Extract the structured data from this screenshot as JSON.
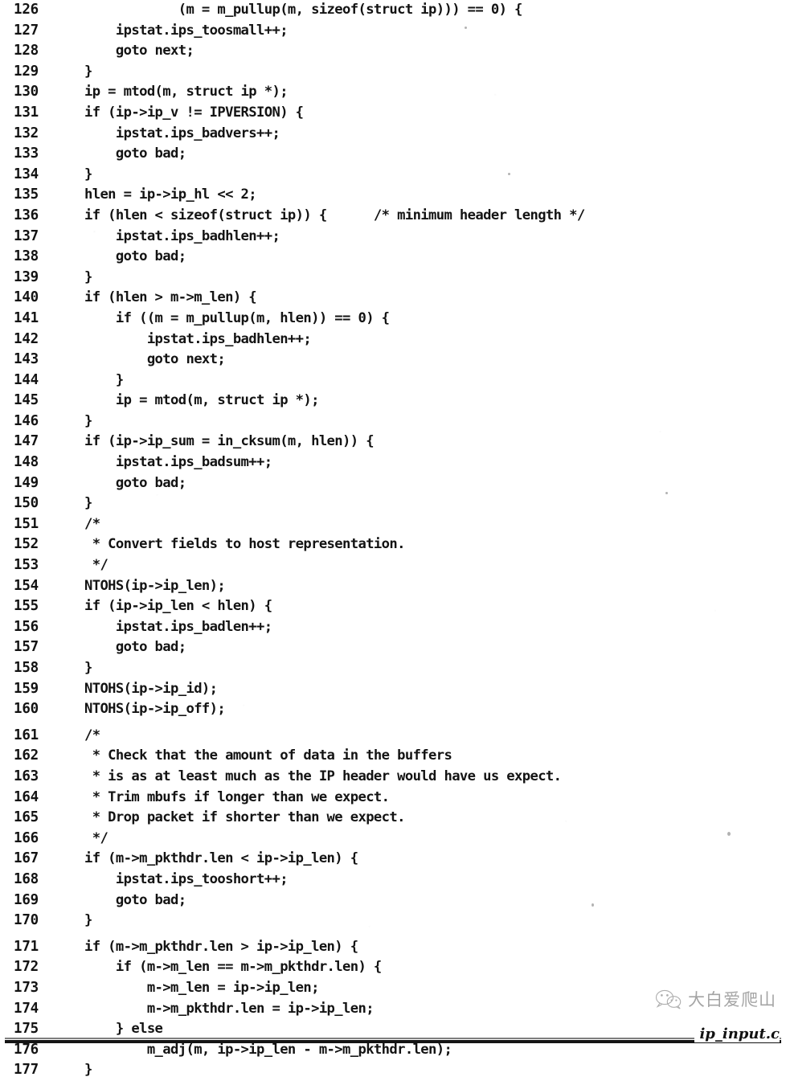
{
  "document": {
    "kind": "scanned-book-page",
    "footer_filename": "ip_input.c",
    "first_line_number": 126,
    "last_line_number": 177
  },
  "watermark": {
    "icon": "wechat-logo-icon",
    "text": "大白爱爬山"
  },
  "code": {
    "language": "c",
    "lines": [
      {
        "no": "126",
        "text": "            (m = m_pullup(m, sizeof(struct ip))) == 0) {",
        "gap_before": false
      },
      {
        "no": "127",
        "text": "    ipstat.ips_toosmall++;",
        "gap_before": false
      },
      {
        "no": "128",
        "text": "    goto next;",
        "gap_before": false
      },
      {
        "no": "129",
        "text": "}",
        "gap_before": false
      },
      {
        "no": "130",
        "text": "ip = mtod(m, struct ip *);",
        "gap_before": false
      },
      {
        "no": "131",
        "text": "if (ip->ip_v != IPVERSION) {",
        "gap_before": false
      },
      {
        "no": "132",
        "text": "    ipstat.ips_badvers++;",
        "gap_before": false
      },
      {
        "no": "133",
        "text": "    goto bad;",
        "gap_before": false
      },
      {
        "no": "134",
        "text": "}",
        "gap_before": false
      },
      {
        "no": "135",
        "text": "hlen = ip->ip_hl << 2;",
        "gap_before": false
      },
      {
        "no": "136",
        "text": "if (hlen < sizeof(struct ip)) {      /* minimum header length */",
        "gap_before": false
      },
      {
        "no": "137",
        "text": "    ipstat.ips_badhlen++;",
        "gap_before": false
      },
      {
        "no": "138",
        "text": "    goto bad;",
        "gap_before": false
      },
      {
        "no": "139",
        "text": "}",
        "gap_before": false
      },
      {
        "no": "140",
        "text": "if (hlen > m->m_len) {",
        "gap_before": false
      },
      {
        "no": "141",
        "text": "    if ((m = m_pullup(m, hlen)) == 0) {",
        "gap_before": false
      },
      {
        "no": "142",
        "text": "        ipstat.ips_badhlen++;",
        "gap_before": false
      },
      {
        "no": "143",
        "text": "        goto next;",
        "gap_before": false
      },
      {
        "no": "144",
        "text": "    }",
        "gap_before": false
      },
      {
        "no": "145",
        "text": "    ip = mtod(m, struct ip *);",
        "gap_before": false
      },
      {
        "no": "146",
        "text": "}",
        "gap_before": false
      },
      {
        "no": "147",
        "text": "if (ip->ip_sum = in_cksum(m, hlen)) {",
        "gap_before": false
      },
      {
        "no": "148",
        "text": "    ipstat.ips_badsum++;",
        "gap_before": false
      },
      {
        "no": "149",
        "text": "    goto bad;",
        "gap_before": false
      },
      {
        "no": "150",
        "text": "}",
        "gap_before": false
      },
      {
        "no": "151",
        "text": "/*",
        "gap_before": false
      },
      {
        "no": "152",
        "text": " * Convert fields to host representation.",
        "gap_before": false
      },
      {
        "no": "153",
        "text": " */",
        "gap_before": false
      },
      {
        "no": "154",
        "text": "NTOHS(ip->ip_len);",
        "gap_before": false
      },
      {
        "no": "155",
        "text": "if (ip->ip_len < hlen) {",
        "gap_before": false
      },
      {
        "no": "156",
        "text": "    ipstat.ips_badlen++;",
        "gap_before": false
      },
      {
        "no": "157",
        "text": "    goto bad;",
        "gap_before": false
      },
      {
        "no": "158",
        "text": "}",
        "gap_before": false
      },
      {
        "no": "159",
        "text": "NTOHS(ip->ip_id);",
        "gap_before": false
      },
      {
        "no": "160",
        "text": "NTOHS(ip->ip_off);",
        "gap_before": false
      },
      {
        "no": "161",
        "text": "/*",
        "gap_before": true
      },
      {
        "no": "162",
        "text": " * Check that the amount of data in the buffers",
        "gap_before": false
      },
      {
        "no": "163",
        "text": " * is as at least much as the IP header would have us expect.",
        "gap_before": false
      },
      {
        "no": "164",
        "text": " * Trim mbufs if longer than we expect.",
        "gap_before": false
      },
      {
        "no": "165",
        "text": " * Drop packet if shorter than we expect.",
        "gap_before": false
      },
      {
        "no": "166",
        "text": " */",
        "gap_before": false
      },
      {
        "no": "167",
        "text": "if (m->m_pkthdr.len < ip->ip_len) {",
        "gap_before": false
      },
      {
        "no": "168",
        "text": "    ipstat.ips_tooshort++;",
        "gap_before": false
      },
      {
        "no": "169",
        "text": "    goto bad;",
        "gap_before": false
      },
      {
        "no": "170",
        "text": "}",
        "gap_before": false
      },
      {
        "no": "171",
        "text": "if (m->m_pkthdr.len > ip->ip_len) {",
        "gap_before": true
      },
      {
        "no": "172",
        "text": "    if (m->m_len == m->m_pkthdr.len) {",
        "gap_before": false
      },
      {
        "no": "173",
        "text": "        m->m_len = ip->ip_len;",
        "gap_before": false
      },
      {
        "no": "174",
        "text": "        m->m_pkthdr.len = ip->ip_len;",
        "gap_before": false
      },
      {
        "no": "175",
        "text": "    } else",
        "gap_before": false
      },
      {
        "no": "176",
        "text": "        m_adj(m, ip->ip_len - m->m_pkthdr.len);",
        "gap_before": false
      },
      {
        "no": "177",
        "text": "}",
        "gap_before": false
      }
    ]
  },
  "colors": {
    "paper": "#ffffff",
    "ink": "#131313",
    "watermark": "#5a5a5a"
  }
}
